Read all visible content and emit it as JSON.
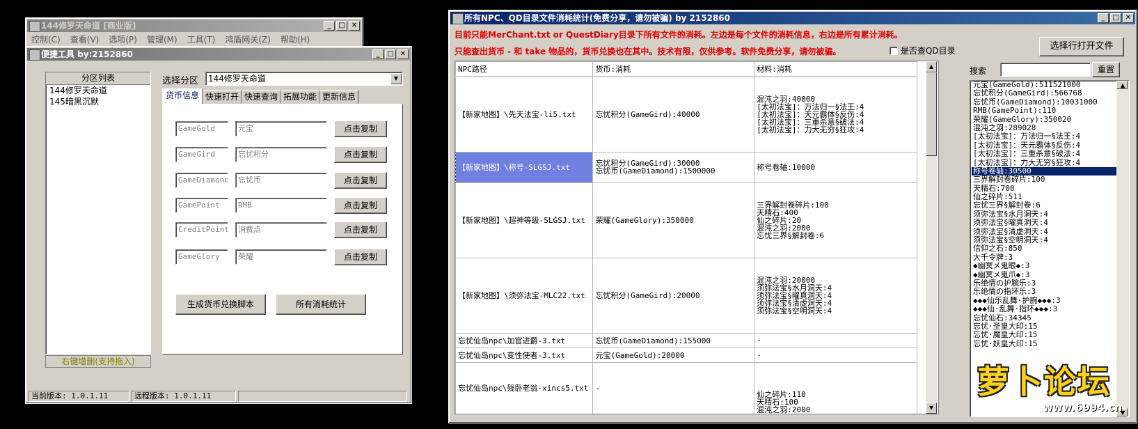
{
  "main_window": {
    "title": "144修罗天命道 [商业版]",
    "menu": [
      "控制(C)",
      "查看(V)",
      "选项(P)",
      "管理(M)",
      "工具(T)",
      "鸿盾网关(Z)",
      "帮助(H)"
    ]
  },
  "tool_window": {
    "title": "便捷工具  by:2152860",
    "partition_list_header": "分区列表",
    "partitions": [
      "144修罗天命道",
      "145暗黑沉默"
    ],
    "partition_hint": "右键增删(支持拖入)",
    "select_label": "选择分区",
    "selected_partition": "144修罗天命道",
    "tabs": [
      "货币信息",
      "快速打开",
      "快速查询",
      "拓展功能",
      "更新信息"
    ],
    "currency_rows": [
      {
        "code": "GameGold",
        "name": "元宝",
        "button": "点击复制"
      },
      {
        "code": "GameGird",
        "name": "忘忧积分",
        "button": "点击复制"
      },
      {
        "code": "GameDiamond",
        "name": "忘忧币",
        "button": "点击复制"
      },
      {
        "code": "GamePoint",
        "name": "RMB",
        "button": "点击复制"
      },
      {
        "code": "CreditPoint",
        "name": "消费点",
        "button": "点击复制"
      },
      {
        "code": "GameGlory",
        "name": "荣耀",
        "button": "点击复制"
      }
    ],
    "gen_button": "生成货币兑换脚本",
    "stats_button": "所有消耗统计"
  },
  "status": {
    "current_version": "当前版本: 1.0.1.11",
    "remote_version": "远程版本: 1.0.1.11"
  },
  "stats_window": {
    "title": "所有NPC、QD目录文件消耗统计(免费分享，请勿被骗)    by 2152860",
    "notice_line1": "目前只能MerChant.txt or QuestDiary目录下所有文件的消耗。左边是每个文件的消耗信息，右边是所有累计消耗。",
    "notice_line2": "只能查出货币 - 和 take 物品的，货币兑换也在其中。技术有限，仅供参考。软件免费分享，请勿被骗。",
    "checkbox_label": "是否查QD目录",
    "open_file_button": "选择行打开文件",
    "search_label": "搜索",
    "reset_button": "重置",
    "columns": [
      "NPC路径",
      "货币:消耗",
      "材料:消耗"
    ],
    "rows": [
      {
        "path": "【新家地图】\\先天法宝-li5.txt",
        "currency": [
          "忘忧积分(GameGird):40000"
        ],
        "materials": [
          "混沌之羽:40000",
          "[太初法宝]：万法归一§法王:4",
          "[太初法宝]：天元霸体§反伤:4",
          "[太初法宝]：三重杀意§破法:4",
          "[太初法宝]：力大无穷§狂攻:4"
        ]
      },
      {
        "path": "【新家地图】\\称号-SLGSJ.txt",
        "currency": [
          "忘忧积分(GameGird):30000",
          "忘忧币(GameDiamond):1500000"
        ],
        "materials": [
          "称号卷轴:10000"
        ]
      },
      {
        "path": "【新家地图】\\超神等级-SLGSJ.txt",
        "currency": [
          "荣耀(GameGlory):350000"
        ],
        "materials": [
          "三界解封卷碎片:100",
          "天精石:400",
          "仙之碎片:20",
          "混沌之羽:2000",
          "忘忧三界§解封卷:6"
        ]
      },
      {
        "path": "【新家地图】\\须弥法宝-MLC22.txt",
        "currency": [
          "忘忧积分(GameGird):20000"
        ],
        "materials": [
          "混沌之羽:20000",
          "须弥法宝§水月洞天:4",
          "须弥法宝§曜真洞天:4",
          "须弥法宝§清虚洞天:4",
          "须弥法宝§空明洞天:4"
        ]
      },
      {
        "path": "忘忧仙岛npc\\加官进爵-3.txt",
        "currency": [
          "忘忧币(GameDiamond):155000"
        ],
        "materials": [
          "-"
        ]
      },
      {
        "path": "忘忧仙岛npc\\变性使者-3.txt",
        "currency": [
          "元宝(GameGold):20000"
        ],
        "materials": [
          "-"
        ]
      },
      {
        "path": "忘忧仙岛npc\\残卧老翁-xincs5.txt",
        "currency": [
          "-"
        ],
        "materials": [
          "仙之碎片:110",
          "天精石:100",
          "混沌之羽:2000"
        ]
      }
    ],
    "totals": [
      "元宝(GameGold):511521000",
      "忘忧积分(GameGird):566768",
      "忘忧币(GameDiamond):10031000",
      "RMB(GamePoint):110",
      "荣耀(GameGlory):350020",
      "混沌之羽:289028",
      "[太初法宝]：万法归一§法王:4",
      "[太初法宝]：天元霸体§反伤:4",
      "[太初法宝]：三重杀意§破法:4",
      "[太初法宝]：力大无穷§狂攻:4",
      "称号卷轴:30500",
      "三界解封卷碎片:100",
      "天精石:700",
      "仙之碎片:511",
      "忘忧三界§解封卷:6",
      "须弥法宝§水月洞天:4",
      "须弥法宝§曜真洞天:4",
      "须弥法宝§清虚洞天:4",
      "须弥法宝§空明洞天:4",
      "信仰之石:850",
      "大千令牌:3",
      "◆幽冥メ鬼眼◆:3",
      "◆幽冥メ鬼爪◆:3",
      "乐绝情の护腕乐:3",
      "乐绝情の指环乐:3",
      "◆◆◆仙乐乱舞·护腕◆◆◆:3",
      "◆◆◆仙·乱舞·指环◆◆◆:3",
      "忘忧仙石:34345",
      "忘忧·圣皇大印:15",
      "忘忧·魔皇大印:15",
      "忘忧·妖皇大印:15"
    ],
    "selected_total_index": 10
  },
  "watermark": {
    "text": "萝卜论坛",
    "url": "www.6994.cn"
  }
}
